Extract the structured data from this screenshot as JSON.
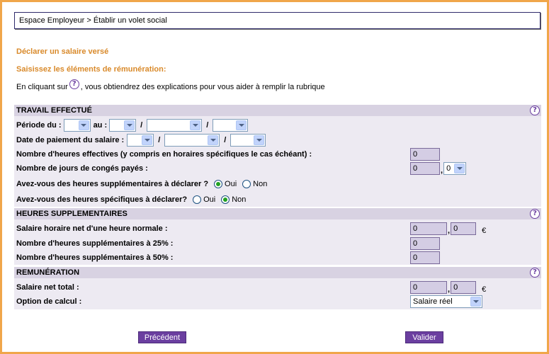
{
  "breadcrumb": "Espace Employeur > Établir un volet social",
  "title1": "Déclarer un salaire versé",
  "title2": "Saisissez les éléments de rémunération:",
  "help_note": {
    "before": "En cliquant sur",
    "icon": "question-icon",
    "after": ", vous obtiendrez des explications pour vous aider à remplir la rubrique"
  },
  "help_symbol": "?",
  "sections": {
    "travail": {
      "header": "TRAVAIL EFFECTUÉ",
      "periode_label": "Période du :",
      "au_label": "au :",
      "slash": "/",
      "date_paiement_label": "Date de paiement du salaire :",
      "heures_effectives_label": "Nombre d'heures effectives (y compris en horaires spécifiques le cas échéant) :",
      "heures_effectives_value": "0",
      "conges_label": "Nombre de jours de congés payés :",
      "conges_int": "0",
      "conges_dec": "0",
      "comma": ",",
      "supp_question": "Avez-vous des heures supplémentaires à déclarer ?",
      "spec_question": "Avez-vous des heures spécifiques à déclarer?",
      "oui": "Oui",
      "non": "Non"
    },
    "heures_supp": {
      "header": "HEURES SUPPLEMENTAIRES",
      "salaire_horaire_label": "Salaire horaire net d'une heure normale :",
      "salaire_horaire_int": "0",
      "salaire_horaire_dec": "0",
      "h25_label": "Nombre d'heures supplémentaires à 25% :",
      "h25_value": "0",
      "h50_label": "Nombre d'heures supplémentaires à 50% :",
      "h50_value": "0",
      "currency": "€"
    },
    "remuneration": {
      "header": "REMUNÉRATION",
      "salaire_net_label": "Salaire net total :",
      "salaire_net_int": "0",
      "salaire_net_dec": "0",
      "option_label": "Option de calcul :",
      "option_value": "Salaire réel",
      "currency": "€"
    }
  },
  "buttons": {
    "previous": "Précédent",
    "submit": "Valider"
  },
  "colors": {
    "frame": "#f0a64a",
    "title_orange": "#d98a2b",
    "section_header": "#d8d2e2",
    "section_body": "#edeaf2",
    "input_fill": "#d4cde4",
    "button": "#6b3fa0"
  }
}
